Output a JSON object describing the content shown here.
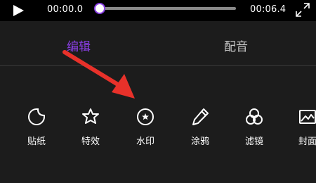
{
  "player": {
    "current_time": "00:00.0",
    "total_time": "00:06.4",
    "progress": 0,
    "accent_color": "#8b3fe6"
  },
  "tabs": [
    {
      "label": "编辑",
      "active": true
    },
    {
      "label": "配音",
      "active": false
    }
  ],
  "tools": [
    {
      "label": "贴纸",
      "icon": "sticker-icon"
    },
    {
      "label": "特效",
      "icon": "effects-star-icon"
    },
    {
      "label": "水印",
      "icon": "watermark-icon"
    },
    {
      "label": "涂鸦",
      "icon": "pencil-icon"
    },
    {
      "label": "滤镜",
      "icon": "filter-circles-icon"
    },
    {
      "label": "封面",
      "icon": "cover-image-icon"
    }
  ],
  "annotation": {
    "color": "#e8312a",
    "icon": "red-arrow"
  }
}
